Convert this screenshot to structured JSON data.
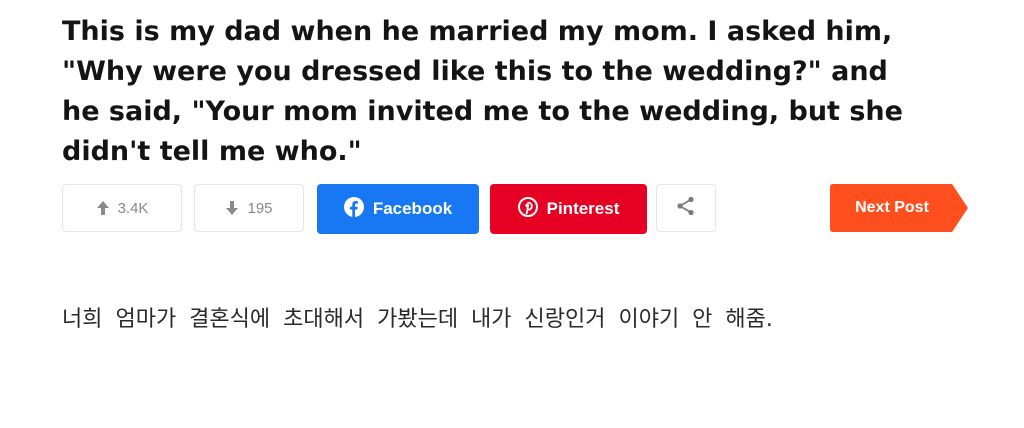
{
  "post": {
    "title_lines": [
      "This is my dad when he married my mom. I asked him,",
      "\"Why were you dressed like this to the wedding?\" and",
      "he said, \"Your mom invited me to the wedding, but she",
      "didn't tell me who.\""
    ],
    "caption": "너희 엄마가 결혼식에 초대해서 가봤는데 내가 신랑인거 이야기 안 해줌."
  },
  "actions": {
    "upvote_count": "3.4K",
    "downvote_count": "195",
    "facebook_label": "Facebook",
    "pinterest_label": "Pinterest",
    "next_label": "Next Post"
  },
  "icons": {
    "upvote": "arrow-up-icon",
    "downvote": "arrow-down-icon",
    "facebook": "facebook-icon",
    "pinterest": "pinterest-icon",
    "share": "share-icon"
  },
  "colors": {
    "facebook": "#1877f2",
    "pinterest": "#e60023",
    "next_post": "#ff4f1f",
    "vote_text": "#8a8a8a"
  }
}
